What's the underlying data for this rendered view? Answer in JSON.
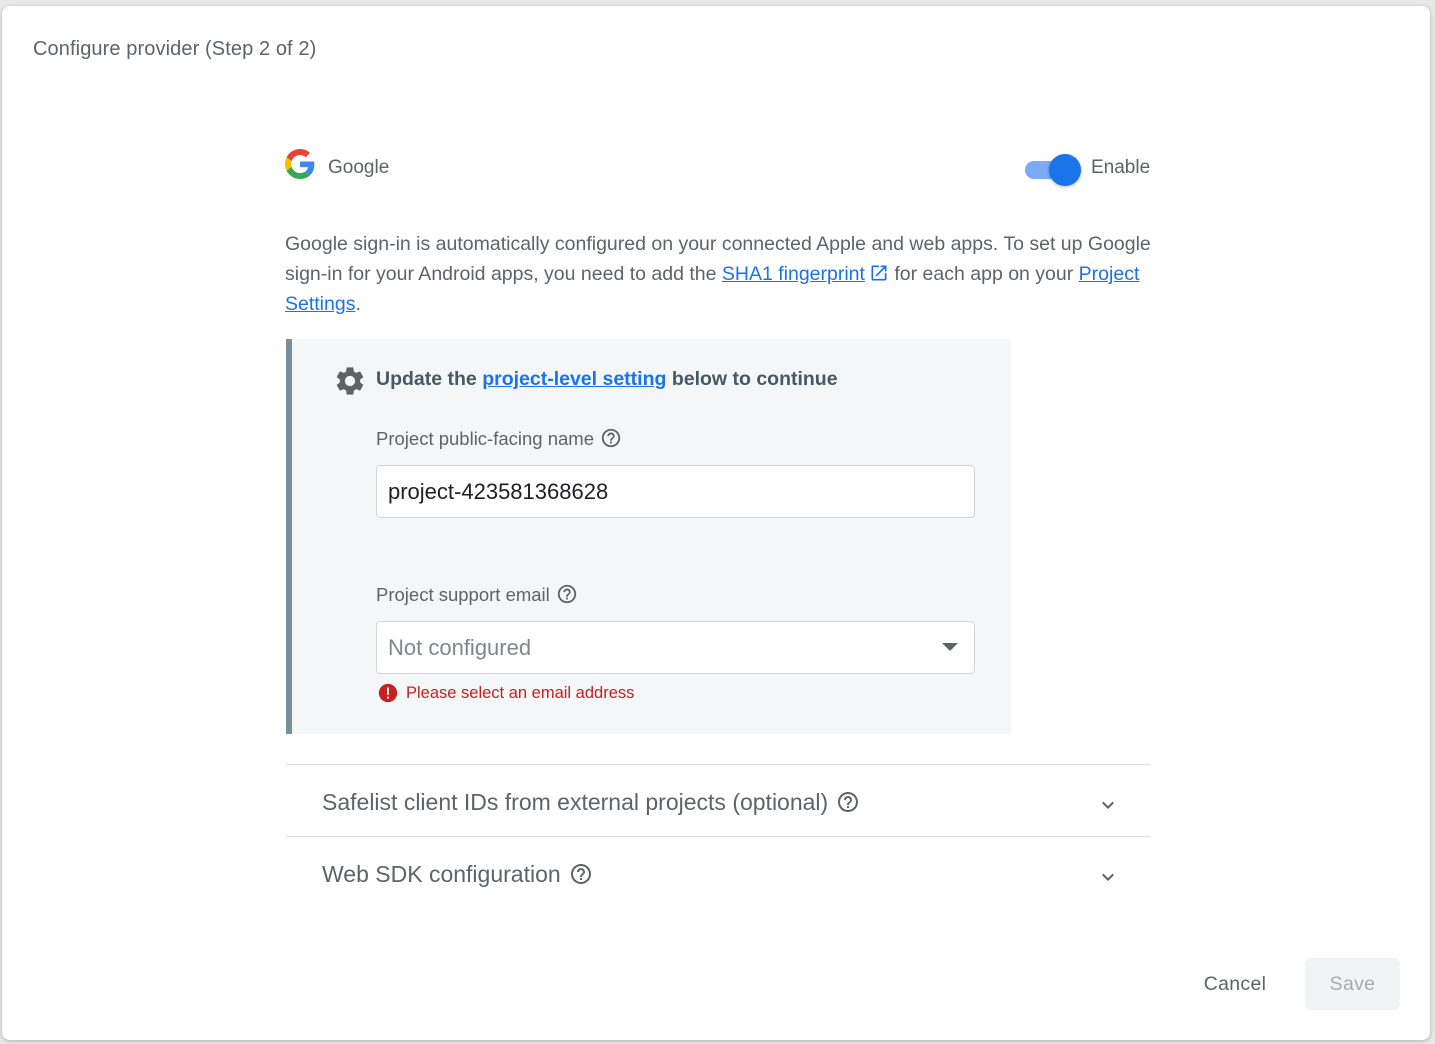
{
  "dialog": {
    "title": "Configure provider (Step 2 of 2)"
  },
  "provider": {
    "name": "Google",
    "enable_label": "Enable",
    "enabled": true,
    "logo_icon": "google-g-logo"
  },
  "description": {
    "part1": "Google sign-in is automatically configured on your connected Apple and web apps. To set up Google sign-in for your Android apps, you need to add the ",
    "sha1_link": "SHA1 fingerprint",
    "part2": " for each app on your ",
    "project_settings_link": "Project Settings",
    "part3": "."
  },
  "project_settings": {
    "heading_prefix": "Update the ",
    "heading_link": "project-level setting",
    "heading_suffix": " below to continue",
    "public_name_label": "Project public-facing name",
    "public_name_value": "project-423581368628",
    "support_email_label": "Project support email",
    "support_email_value": "Not configured",
    "error_message": "Please select an email address"
  },
  "expanders": [
    {
      "title": "Safelist client IDs from external projects (optional)"
    },
    {
      "title": "Web SDK configuration"
    }
  ],
  "actions": {
    "cancel_label": "Cancel",
    "save_label": "Save"
  },
  "colors": {
    "accent": "#1a73e8",
    "error": "#c5221f",
    "callout_border": "#78909c",
    "callout_bg": "#f5f6f7"
  }
}
